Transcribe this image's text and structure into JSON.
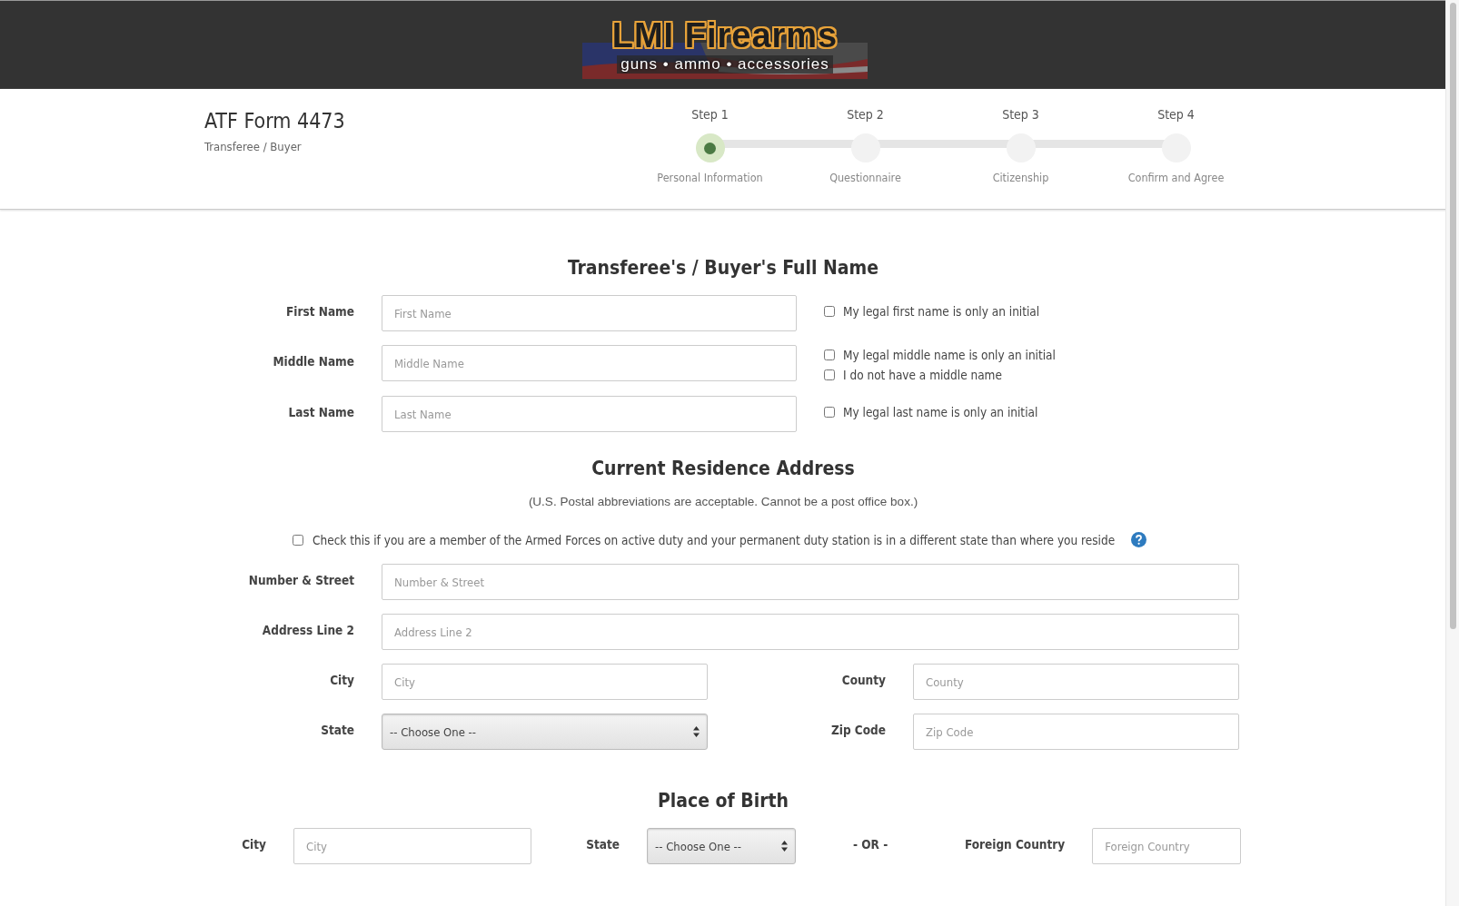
{
  "header": {
    "logo_title": "LMI Firearms",
    "logo_tagline": "guns • ammo • accessories"
  },
  "form_header": {
    "title": "ATF Form 4473",
    "subtitle": "Transferee / Buyer"
  },
  "steps": [
    {
      "label": "Step 1",
      "caption": "Personal Information",
      "selected": true
    },
    {
      "label": "Step 2",
      "caption": "Questionnaire",
      "selected": false
    },
    {
      "label": "Step 3",
      "caption": "Citizenship",
      "selected": false
    },
    {
      "label": "Step 4",
      "caption": "Confirm and Agree",
      "selected": false
    }
  ],
  "name_section": {
    "heading": "Transferee's / Buyer's Full Name",
    "fields": [
      {
        "label": "First Name",
        "placeholder": "First Name",
        "options": [
          {
            "label": "My legal first name is only an initial",
            "checked": false
          }
        ]
      },
      {
        "label": "Middle Name",
        "placeholder": "Middle Name",
        "options": [
          {
            "label": "My legal middle name is only an initial",
            "checked": false
          },
          {
            "label": "I do not have a middle name",
            "checked": false
          }
        ]
      },
      {
        "label": "Last Name",
        "placeholder": "Last Name",
        "options": [
          {
            "label": "My legal last name is only an initial",
            "checked": false
          }
        ]
      }
    ]
  },
  "address_section": {
    "heading": "Current Residence Address",
    "note": "(U.S. Postal abbreviations are acceptable. Cannot be a post office box.)",
    "armed_forces": {
      "label": "Check this if you are a member of the Armed Forces on active duty and your permanent duty station is in a different state than where you reside",
      "checked": false
    },
    "rows": [
      [
        {
          "kind": "text",
          "label": "Number & Street",
          "placeholder": "Number & Street"
        }
      ],
      [
        {
          "kind": "text",
          "label": "Address Line 2",
          "placeholder": "Address Line 2"
        }
      ],
      [
        {
          "kind": "text",
          "label": "City",
          "placeholder": "City"
        },
        {
          "kind": "text",
          "label": "County",
          "placeholder": "County"
        }
      ],
      [
        {
          "kind": "select",
          "label": "State",
          "value": "-- Choose One --"
        },
        {
          "kind": "text",
          "label": "Zip Code",
          "placeholder": "Zip Code"
        }
      ]
    ]
  },
  "birth_section": {
    "heading": "Place of Birth",
    "city": {
      "label": "City",
      "placeholder": "City"
    },
    "state": {
      "label": "State",
      "value": "-- Choose One --"
    },
    "separator": "- OR -",
    "foreign_country": {
      "label": "Foreign Country",
      "placeholder": "Foreign Country"
    }
  }
}
